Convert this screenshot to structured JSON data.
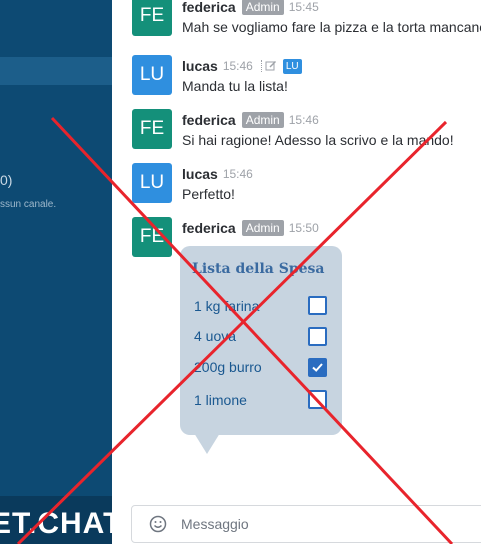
{
  "sidebar": {
    "channel_count": "0)",
    "empty_text": "ssun canale.",
    "logo": "ET.CHAT"
  },
  "messages": [
    {
      "initials": "FE",
      "user": "federica",
      "role": "Admin",
      "time": "15:45",
      "text": "Mah se vogliamo fare la pizza e la torta mancano"
    },
    {
      "initials": "LU",
      "user": "lucas",
      "time": "15:46",
      "edited_by": "LU",
      "text": "Manda tu la lista!"
    },
    {
      "initials": "FE",
      "user": "federica",
      "role": "Admin",
      "time": "15:46",
      "text": "Si hai ragione! Adesso la scrivo e la mando!"
    },
    {
      "initials": "LU",
      "user": "lucas",
      "time": "15:46",
      "text": "Perfetto!"
    },
    {
      "initials": "FE",
      "user": "federica",
      "role": "Admin",
      "time": "15:50"
    }
  ],
  "shopping_list": {
    "title": "Lista della Spesa",
    "items": [
      {
        "text": "1 kg farina",
        "checked": false
      },
      {
        "text": "4 uova",
        "checked": false
      },
      {
        "text": "200g burro",
        "checked": true
      },
      {
        "text": "1 limone",
        "checked": false
      }
    ]
  },
  "composer": {
    "placeholder": "Messaggio",
    "emoji_icon": "emoji-icon"
  },
  "colors": {
    "sidebar": "#0d4a73",
    "overlay_cross": "#e8242c",
    "admin_badge": "#9ea2a8",
    "checkbox": "#2a6cc0"
  }
}
